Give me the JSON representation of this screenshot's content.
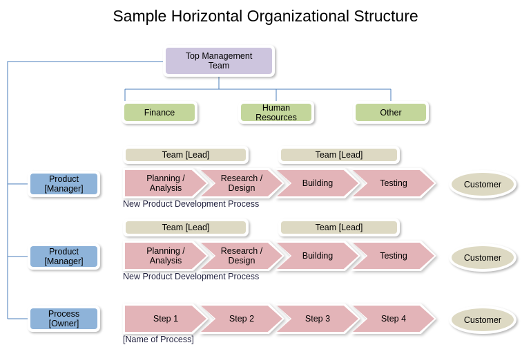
{
  "title": "Sample Horizontal Organizational Structure",
  "colors": {
    "top_management_fill": "#cdc5de",
    "department_fill": "#c3d69b",
    "owner_fill": "#8eb3d9",
    "team_fill": "#ddd9c3",
    "process_step_fill": "#e3b4b8",
    "customer_fill": "#ddd9c3",
    "connector_line": "#4a7ebb",
    "caption_text": "#1f1f3d"
  },
  "top_management": {
    "label": "Top Management\nTeam"
  },
  "departments": [
    {
      "label": "Finance"
    },
    {
      "label": "Human\nResources"
    },
    {
      "label": "Other"
    }
  ],
  "rows": [
    {
      "owner_label": "Product\n[Manager]",
      "teams": [
        {
          "label": "Team [Lead]"
        },
        {
          "label": "Team [Lead]"
        }
      ],
      "steps": [
        {
          "label": "Planning /\nAnalysis"
        },
        {
          "label": "Research /\nDesign"
        },
        {
          "label": "Building"
        },
        {
          "label": "Testing"
        }
      ],
      "caption": "New Product Development Process",
      "customer_label": "Customer"
    },
    {
      "owner_label": "Product\n[Manager]",
      "teams": [
        {
          "label": "Team [Lead]"
        },
        {
          "label": "Team [Lead]"
        }
      ],
      "steps": [
        {
          "label": "Planning /\nAnalysis"
        },
        {
          "label": "Research /\nDesign"
        },
        {
          "label": "Building"
        },
        {
          "label": "Testing"
        }
      ],
      "caption": "New Product Development Process",
      "customer_label": "Customer"
    },
    {
      "owner_label": "Process\n[Owner]",
      "teams": [],
      "steps": [
        {
          "label": "Step 1"
        },
        {
          "label": "Step 2"
        },
        {
          "label": "Step 3"
        },
        {
          "label": "Step 4"
        }
      ],
      "caption": "[Name of Process]",
      "customer_label": "Customer"
    }
  ]
}
